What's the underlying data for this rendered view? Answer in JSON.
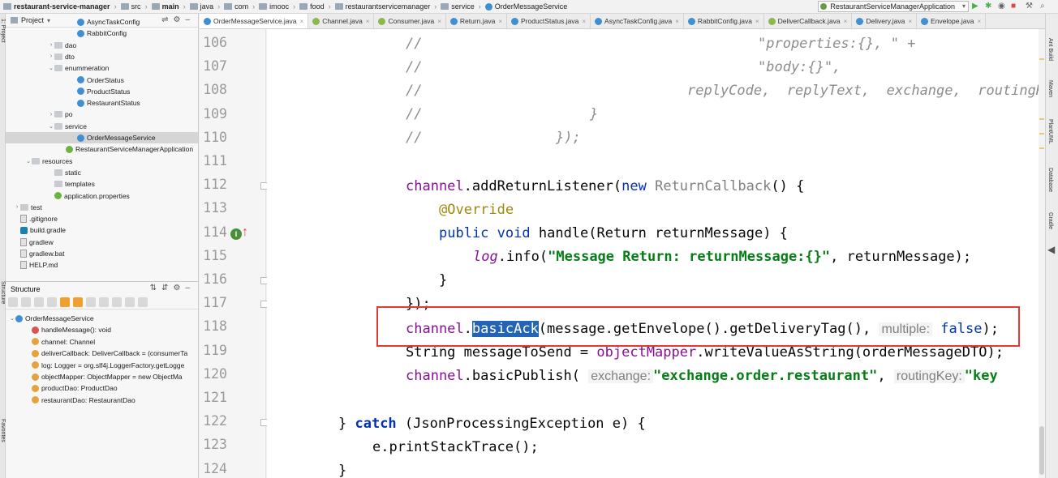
{
  "breadcrumb": [
    {
      "label": "restaurant-service-manager",
      "bold": true,
      "icon": "folder"
    },
    {
      "label": "src",
      "icon": "folder"
    },
    {
      "label": "main",
      "bold": true,
      "icon": "folder"
    },
    {
      "label": "java",
      "icon": "folder"
    },
    {
      "label": "com",
      "icon": "folder"
    },
    {
      "label": "imooc",
      "icon": "folder"
    },
    {
      "label": "food",
      "icon": "folder"
    },
    {
      "label": "restaurantservicemanager",
      "icon": "folder"
    },
    {
      "label": "service",
      "icon": "folder"
    },
    {
      "label": "OrderMessageService",
      "icon": "class"
    }
  ],
  "run_config": "RestaurantServiceManagerApplication",
  "project_panel": {
    "title": "Project",
    "tree": [
      {
        "label": "AsyncTaskConfig",
        "icon": "class",
        "indent": 80,
        "arrow": ""
      },
      {
        "label": "RabbitConfig",
        "icon": "class",
        "indent": 80,
        "arrow": ""
      },
      {
        "label": "dao",
        "icon": "folder",
        "indent": 52,
        "arrow": "›"
      },
      {
        "label": "dto",
        "icon": "folder",
        "indent": 52,
        "arrow": "›"
      },
      {
        "label": "enummeration",
        "icon": "folder",
        "indent": 52,
        "arrow": "⌄"
      },
      {
        "label": "OrderStatus",
        "icon": "class",
        "indent": 80,
        "arrow": ""
      },
      {
        "label": "ProductStatus",
        "icon": "class",
        "indent": 80,
        "arrow": ""
      },
      {
        "label": "RestaurantStatus",
        "icon": "class",
        "indent": 80,
        "arrow": ""
      },
      {
        "label": "po",
        "icon": "folder",
        "indent": 52,
        "arrow": "›"
      },
      {
        "label": "service",
        "icon": "folder",
        "indent": 52,
        "arrow": "⌄"
      },
      {
        "label": "OrderMessageService",
        "icon": "class",
        "indent": 80,
        "arrow": "",
        "selected": true
      },
      {
        "label": "RestaurantServiceManagerApplication",
        "icon": "spring",
        "indent": 66,
        "arrow": ""
      },
      {
        "label": "resources",
        "icon": "folder",
        "indent": 24,
        "arrow": "⌄"
      },
      {
        "label": "static",
        "icon": "folder",
        "indent": 52,
        "arrow": ""
      },
      {
        "label": "templates",
        "icon": "folder",
        "indent": 52,
        "arrow": ""
      },
      {
        "label": "application.properties",
        "icon": "spring",
        "indent": 52,
        "arrow": ""
      },
      {
        "label": "test",
        "icon": "folder",
        "indent": 10,
        "arrow": "›"
      },
      {
        "label": ".gitignore",
        "icon": "file",
        "indent": 10,
        "arrow": ""
      },
      {
        "label": "build.gradle",
        "icon": "gradle",
        "indent": 10,
        "arrow": ""
      },
      {
        "label": "gradlew",
        "icon": "file",
        "indent": 10,
        "arrow": ""
      },
      {
        "label": "gradlew.bat",
        "icon": "file",
        "indent": 10,
        "arrow": ""
      },
      {
        "label": "HELP.md",
        "icon": "file",
        "indent": 10,
        "arrow": ""
      }
    ]
  },
  "structure_panel": {
    "title": "Structure",
    "items": [
      {
        "label": "OrderMessageService",
        "icon": "class",
        "indent": 4,
        "arrow": "⌄"
      },
      {
        "label": "handleMessage(): void",
        "icon": "method",
        "indent": 24,
        "arrow": ""
      },
      {
        "label": "channel: Channel",
        "icon": "field",
        "indent": 24,
        "arrow": ""
      },
      {
        "label": "deliverCallback: DeliverCallback = (consumerTa",
        "icon": "field",
        "indent": 24,
        "arrow": ""
      },
      {
        "label": "log: Logger = org.slf4j.LoggerFactory.getLogge",
        "icon": "field",
        "indent": 24,
        "arrow": ""
      },
      {
        "label": "objectMapper: ObjectMapper = new ObjectMa",
        "icon": "field",
        "indent": 24,
        "arrow": ""
      },
      {
        "label": "productDao: ProductDao",
        "icon": "field",
        "indent": 24,
        "arrow": ""
      },
      {
        "label": "restaurantDao: RestaurantDao",
        "icon": "field",
        "indent": 24,
        "arrow": ""
      }
    ]
  },
  "tabs": [
    {
      "label": "OrderMessageService.java",
      "active": true,
      "icon": "class"
    },
    {
      "label": "Channel.java",
      "icon": "interface"
    },
    {
      "label": "Consumer.java",
      "icon": "interface"
    },
    {
      "label": "Return.java",
      "icon": "class"
    },
    {
      "label": "ProductStatus.java",
      "icon": "class"
    },
    {
      "label": "AsyncTaskConfig.java",
      "icon": "class"
    },
    {
      "label": "RabbitConfig.java",
      "icon": "class"
    },
    {
      "label": "DeliverCallback.java",
      "icon": "interface"
    },
    {
      "label": "Delivery.java",
      "icon": "class"
    },
    {
      "label": "Envelope.java",
      "icon": "class"
    }
  ],
  "right_tool_tabs": [
    "Ant Build",
    "Maven",
    "PlantUML",
    "Database",
    "Gradle"
  ],
  "left_tool_tabs": [
    "1: Project",
    "Structure",
    "Favorites"
  ],
  "line_numbers": [
    106,
    107,
    108,
    109,
    110,
    111,
    112,
    113,
    114,
    115,
    116,
    117,
    118,
    119,
    120,
    121,
    122,
    123,
    124
  ],
  "code": {
    "l106_a": "//",
    "l106_b": "\"properties:{}, \" +",
    "l107_a": "//",
    "l107_b": "\"body:{}\",",
    "l108_a": "//",
    "l108_b": "replyCode,  replyText,  exchange,  routingK",
    "l109_a": "//",
    "l109_b": "}",
    "l110_a": "//",
    "l110_b": "});",
    "l112_a": "channel",
    "l112_b": ".addReturnListener(",
    "l112_c": "new",
    "l112_d": " ReturnCallback",
    "l112_e": "() {",
    "l113": "@Override",
    "l114_a": "public",
    "l114_b": "void",
    "l114_c": " handle(Return returnMessage) {",
    "l115_a": "log",
    "l115_b": ".info(",
    "l115_c": "\"Message Return: returnMessage:{}\"",
    "l115_d": ", returnMessage);",
    "l116": "}",
    "l117": "});",
    "l118_a": "channel",
    "l118_b": ".",
    "l118_c": "basicAck",
    "l118_d": "(message.getEnvelope().getDeliveryTag(), ",
    "l118_hint": "multiple:",
    "l118_e": "false",
    "l118_f": ");",
    "l119_a": "String messageToSend = ",
    "l119_b": "objectMapper",
    "l119_c": ".writeValueAsString(orderMessageDTO);",
    "l120_a": "channel",
    "l120_b": ".basicPublish( ",
    "l120_hint1": "exchange:",
    "l120_c": "\"exchange.order.restaurant\"",
    "l120_d": ", ",
    "l120_hint2": "routingKey:",
    "l120_e": "\"key",
    "l122_a": "} ",
    "l122_b": "catch",
    "l122_c": " (JsonProcessingException e) {",
    "l123": "e.printStackTrace();",
    "l124": "}"
  },
  "colors": {
    "highlight_box": "#e53935",
    "selection": "#2464b8",
    "keyword": "#0033b3",
    "string": "#067d17",
    "field": "#871094",
    "comment": "#8c8c8c"
  }
}
